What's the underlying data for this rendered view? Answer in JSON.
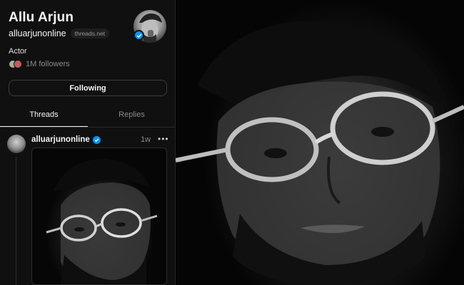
{
  "profile": {
    "name": "Allu Arjun",
    "handle": "alluarjunonline",
    "domain_badge": "threads.net",
    "bio": "Actor",
    "followers": "1M followers",
    "follow_button": "Following",
    "verified_icon": "verified-check-icon"
  },
  "tabs": [
    {
      "label": "Threads",
      "active": true
    },
    {
      "label": "Replies",
      "active": false
    }
  ],
  "post": {
    "username": "alluarjunonline",
    "time": "1w",
    "more_icon": "more-dots-icon"
  },
  "colors": {
    "background": "#101010",
    "text": "#f3f5f7",
    "muted": "#8a8a8a",
    "verified": "#0095f6"
  }
}
